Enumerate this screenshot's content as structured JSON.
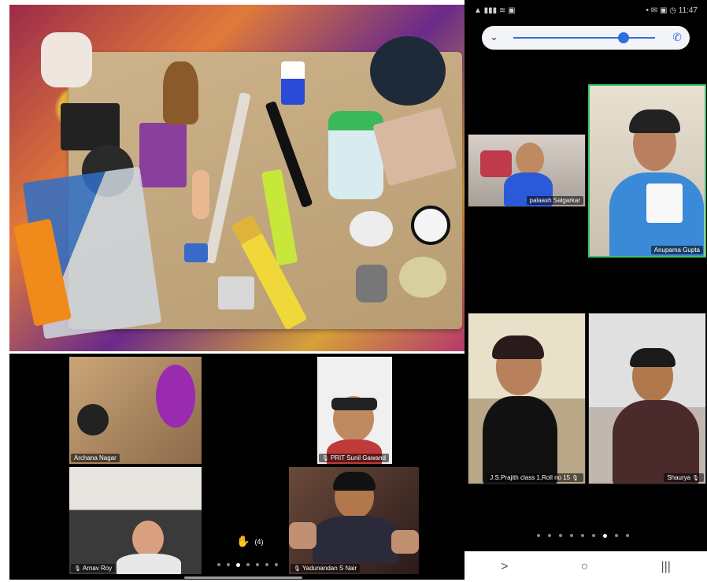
{
  "left_meeting": {
    "participants": [
      {
        "name": "Archana Nagar"
      },
      {
        "name": "PRIT Sunil Gawand"
      },
      {
        "name": "Arnav Roy"
      },
      {
        "name": "Yadunandan S Nair"
      }
    ],
    "raise_hand_count": "(4)",
    "raise_hand_icon": "raised-hand-icon"
  },
  "phone": {
    "status_time": "11:47",
    "participants": [
      {
        "name": "palaash Salgarkar"
      },
      {
        "name": "Anupama Gupta"
      },
      {
        "name": "J.S.Prajith class 1,Roll no 15"
      },
      {
        "name": "Shaurya"
      }
    ],
    "active_speaker_color": "#3ac46a",
    "slider_color": "#2f6fe0",
    "slider_level": 0.78,
    "nav": {
      "back": ">",
      "home": "○",
      "recents": "|||"
    }
  }
}
